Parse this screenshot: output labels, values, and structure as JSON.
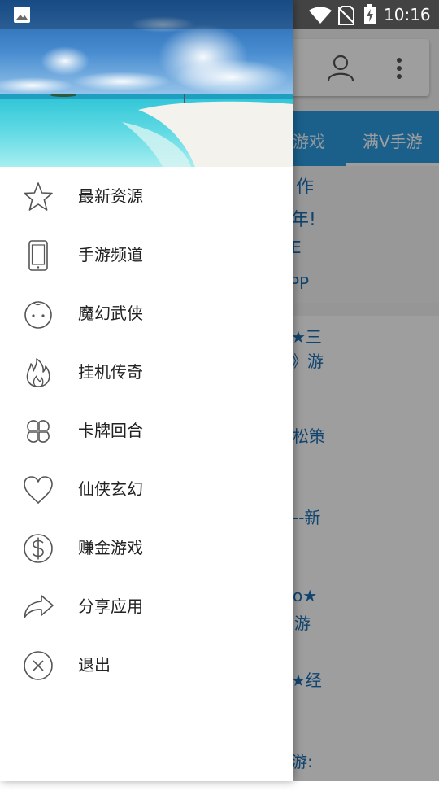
{
  "status_bar": {
    "time": "10:16",
    "icons": [
      "image-notification-icon",
      "wifi-icon",
      "no-sim-icon",
      "battery-charging-icon"
    ]
  },
  "background_app": {
    "toolbar_icons": [
      "account-icon",
      "more-vert-icon"
    ],
    "tabs": [
      {
        "label": "游戏"
      },
      {
        "label": "满V手游"
      }
    ],
    "banner_lines": [
      "作",
      "年!",
      "E",
      "PP"
    ],
    "rows": [
      {
        "line1": "★三",
        "line2": "》游"
      },
      {
        "line1": "松策",
        "line2": ""
      },
      {
        "line1": "--新",
        "line2": ""
      },
      {
        "line1": "o★",
        "line2": "游"
      },
      {
        "line1": "★经",
        "line2": ""
      },
      {
        "line1": "游:",
        "line2": ""
      }
    ],
    "accent_color": "#2a9be0"
  },
  "drawer": {
    "header_image": "tropical-beach-image",
    "menu": [
      {
        "label": "最新资源",
        "icon": "star-outline-icon"
      },
      {
        "label": "手游频道",
        "icon": "phone-outline-icon"
      },
      {
        "label": "魔幻武侠",
        "icon": "face-outline-icon"
      },
      {
        "label": "挂机传奇",
        "icon": "fire-outline-icon"
      },
      {
        "label": "卡牌回合",
        "icon": "clover-outline-icon"
      },
      {
        "label": "仙侠玄幻",
        "icon": "heart-outline-icon"
      },
      {
        "label": "赚金游戏",
        "icon": "dollar-circle-icon"
      },
      {
        "label": "分享应用",
        "icon": "share-arrow-icon"
      },
      {
        "label": "退出",
        "icon": "close-circle-icon"
      }
    ]
  }
}
